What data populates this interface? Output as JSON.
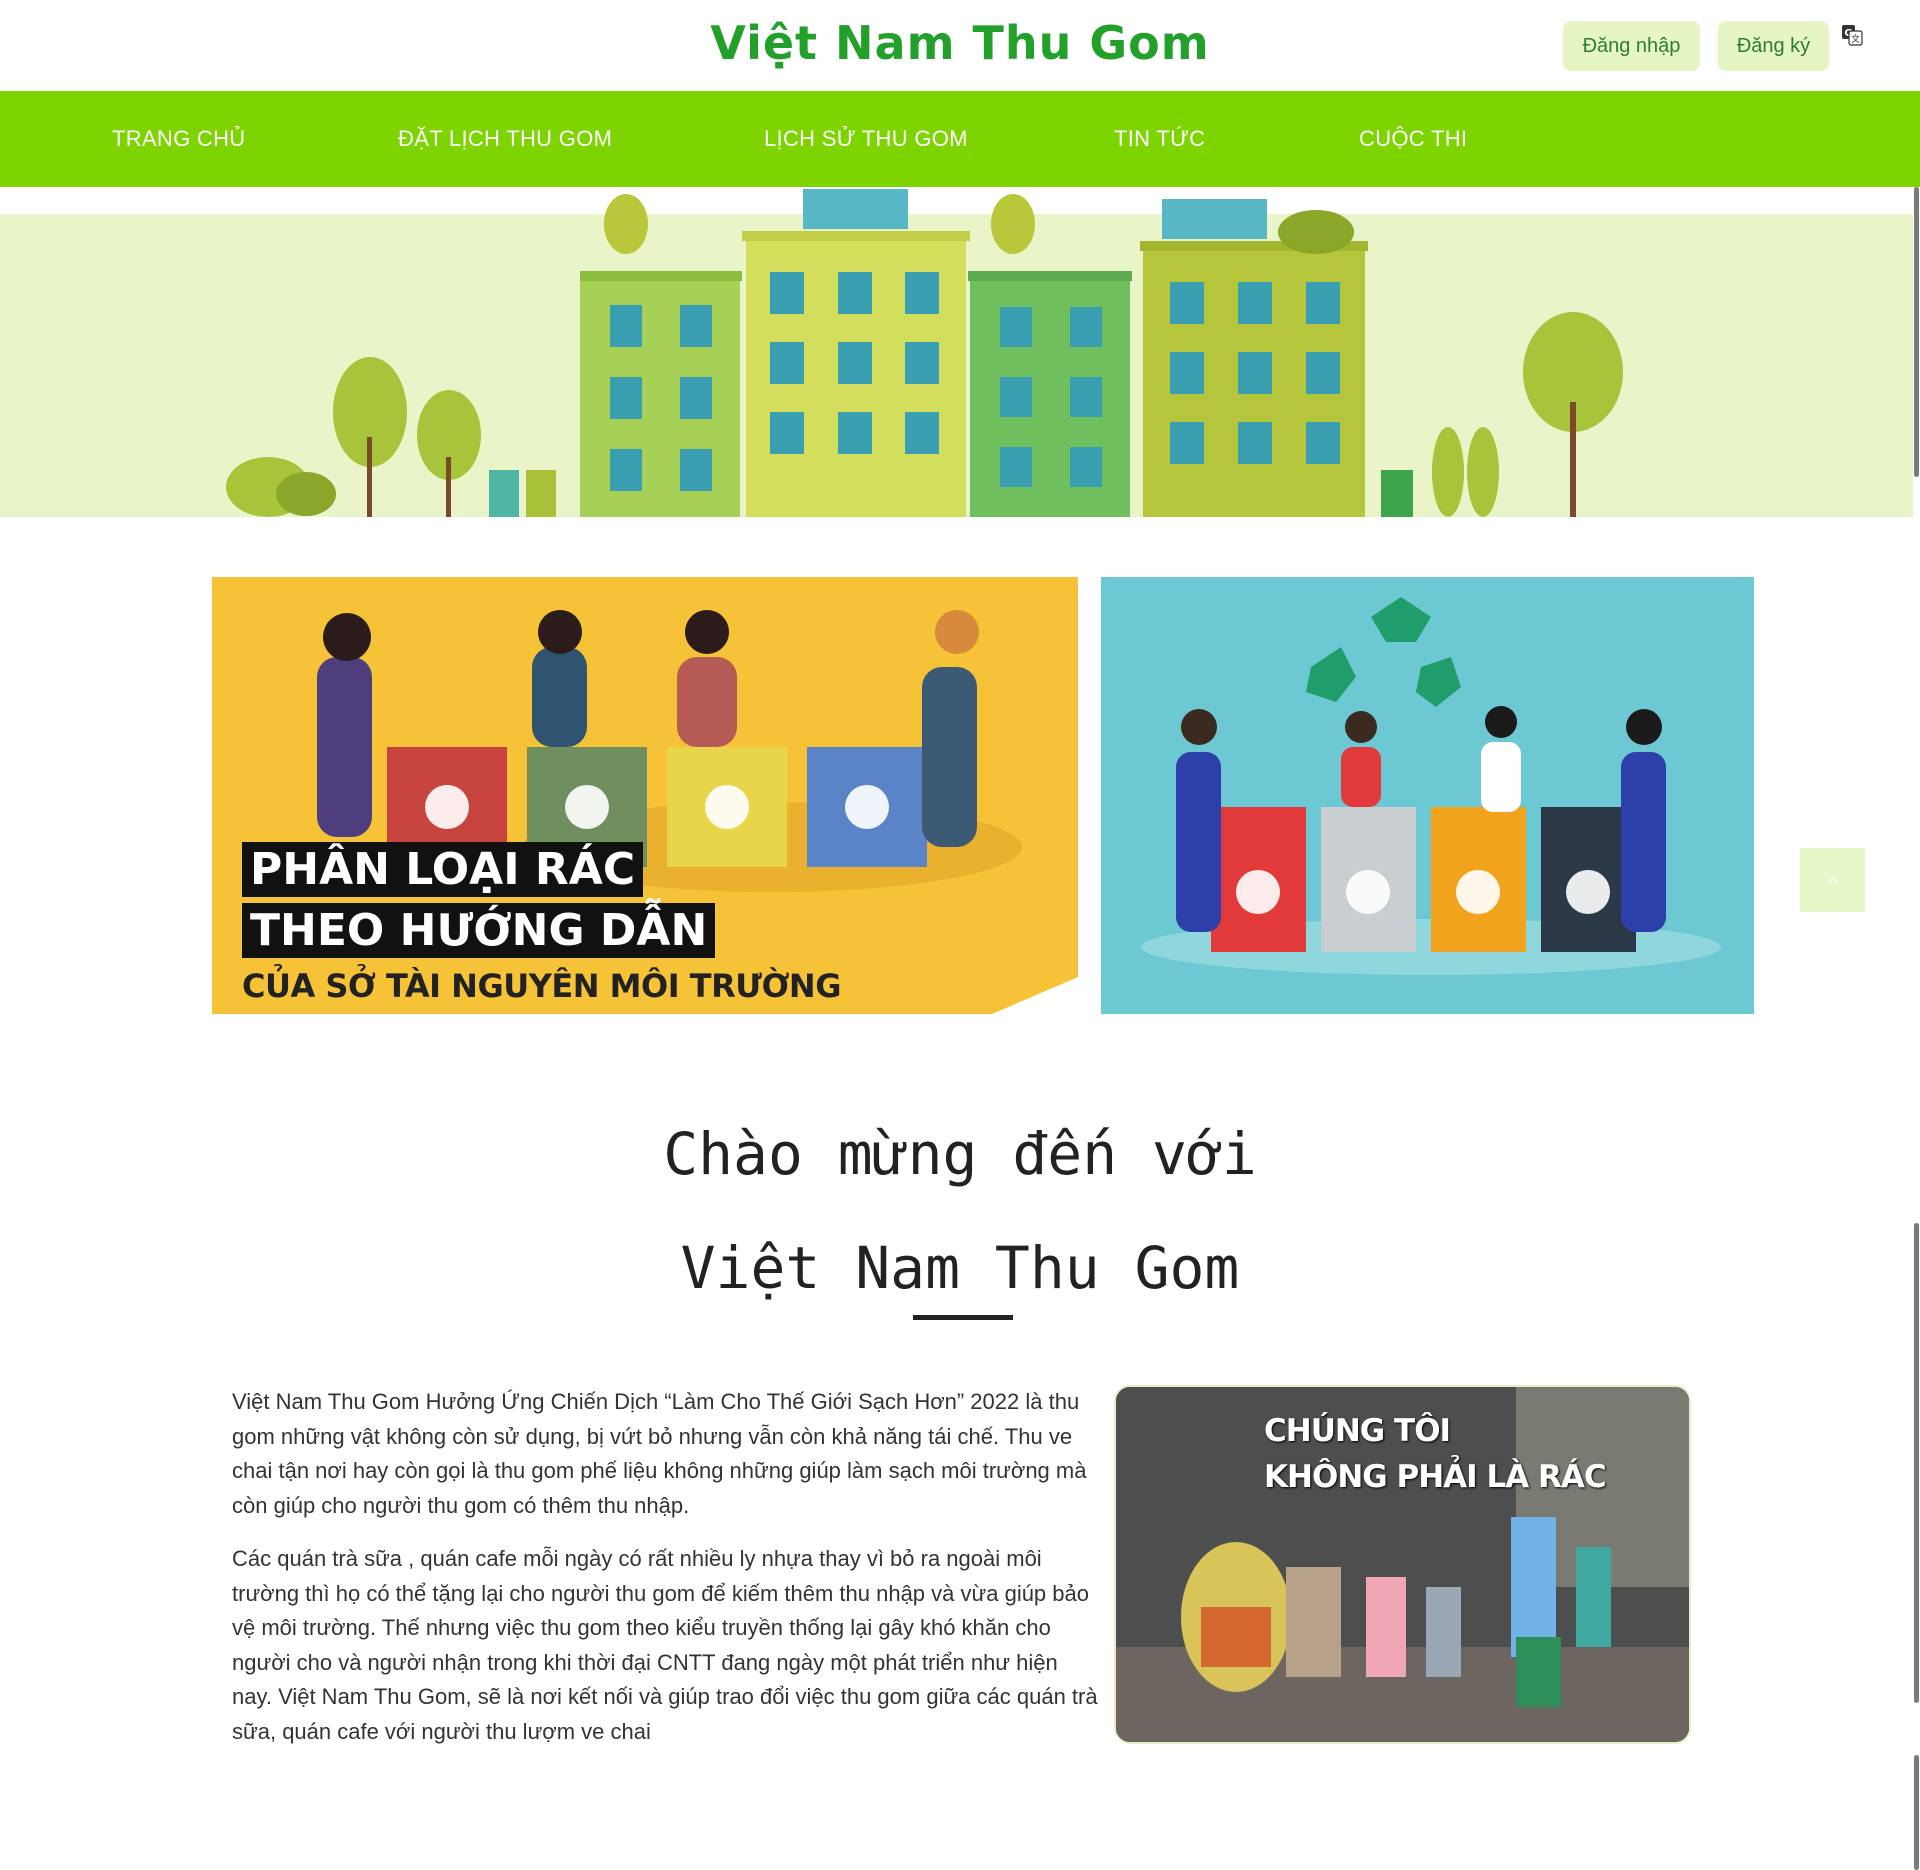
{
  "header": {
    "brand": "Việt Nam Thu Gom",
    "login_label": "Đăng nhập",
    "register_label": "Đăng ký",
    "translate_icon": "google-translate-icon"
  },
  "nav": {
    "items": [
      {
        "label": "TRANG CHỦ"
      },
      {
        "label": "ĐẶT LỊCH THU GOM"
      },
      {
        "label": "LỊCH SỬ THU GOM"
      },
      {
        "label": "TIN TỨC"
      },
      {
        "label": "CUỘC THI"
      }
    ]
  },
  "features": {
    "left": {
      "line1": "PHÂN LOẠI RÁC",
      "line2": "THEO HƯỚNG DẪN",
      "line3": "CỦA SỞ TÀI NGUYÊN MÔI TRƯỜNG"
    }
  },
  "welcome": {
    "line1": "Chào mừng đến với",
    "line2": "Việt Nam Thu Gom"
  },
  "intro": {
    "paragraph1": "Việt Nam Thu Gom Hưởng Ứng Chiến Dịch “Làm Cho Thế Giới Sạch Hơn” 2022 là thu gom những vật không còn sử dụng, bị vứt bỏ nhưng vẫn còn khả năng tái chế. Thu ve chai tận nơi hay còn gọi là thu gom phế liệu không những giúp làm sạch môi trường mà còn giúp cho người thu gom có thêm thu nhập.",
    "paragraph2": "Các quán trà sữa , quán cafe mỗi ngày có rất nhiều ly nhựa thay vì bỏ ra ngoài môi trường thì họ có thể tặng lại cho người thu gom để kiếm thêm thu nhập và vừa giúp bảo vệ môi trường. Thế nhưng việc thu gom theo kiểu truyền thống lại gây khó khăn cho người cho và người nhận trong khi thời đại CNTT đang ngày một phát triển như hiện nay. Việt Nam Thu Gom, sẽ là nơi kết nối và giúp trao đổi việc thu gom giữa các quán trà sữa, quán cafe với người thu lượm ve chai",
    "photo_line1": "CHÚNG TÔI",
    "photo_line2": "KHÔNG PHẢI LÀ RÁC"
  },
  "colors": {
    "brand_green": "#23a02a",
    "nav_green": "#7ed400",
    "button_bg": "#e6f5c4"
  }
}
